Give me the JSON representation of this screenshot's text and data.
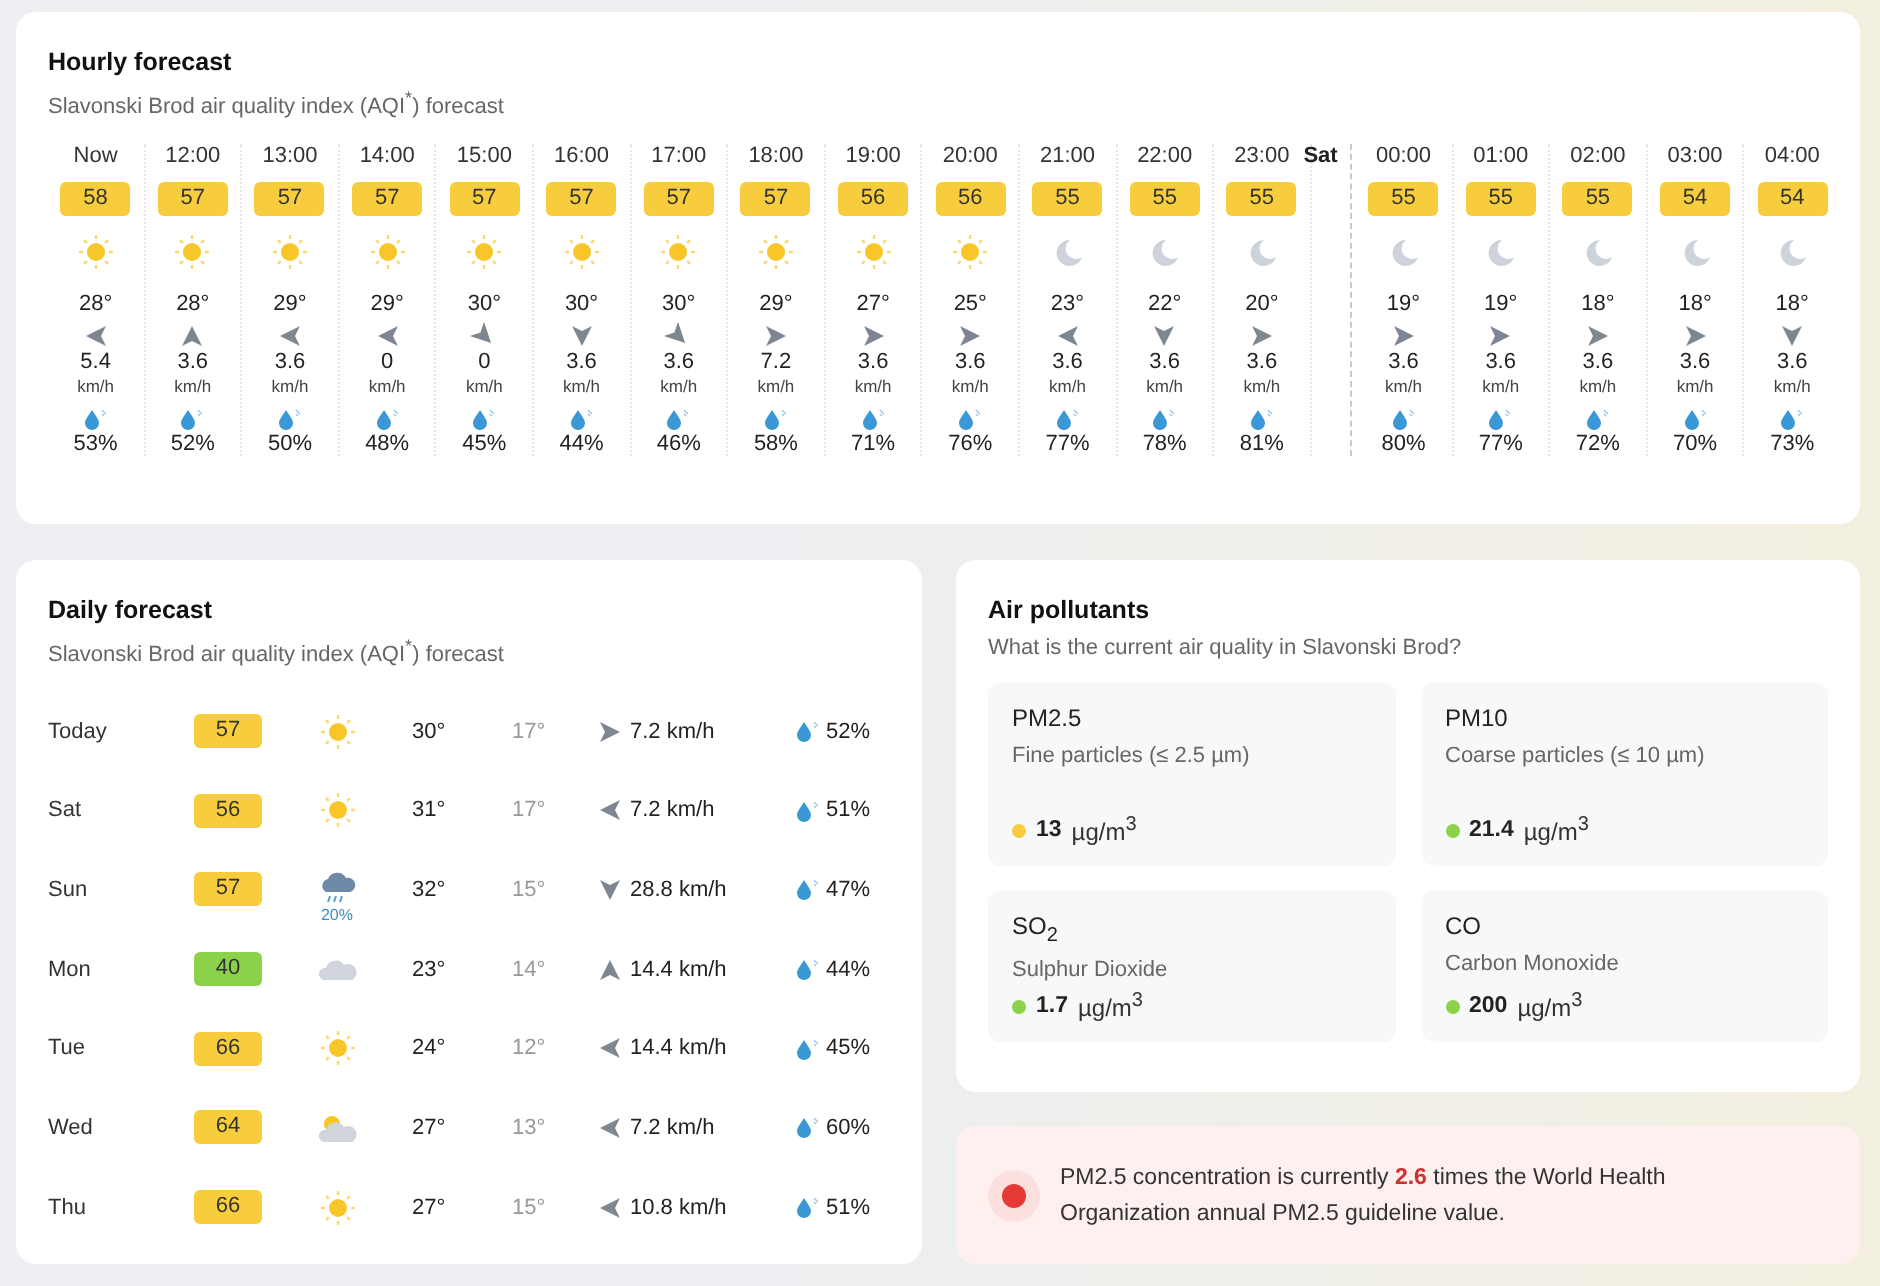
{
  "hourly": {
    "title": "Hourly forecast",
    "subtitle": "Slavonski Brod air quality index (AQI$^{*}$) forecast",
    "days": [
      {
        "hours": [
          {
            "kind": "sun",
            "time": "Now",
            "aqi": "58",
            "color": "#f8cd3d",
            "temp": "28°",
            "wind": {
              "kind": "W",
              "speed": "5.4",
              "unit": "km/h"
            },
            "humidity": "53%"
          },
          {
            "kind": "sun",
            "time": "12:00",
            "aqi": "57",
            "color": "#f8cd3d",
            "temp": "28°",
            "wind": {
              "kind": "N",
              "speed": "3.6",
              "unit": "km/h"
            },
            "humidity": "52%"
          },
          {
            "kind": "sun",
            "time": "13:00",
            "aqi": "57",
            "color": "#f8cd3d",
            "temp": "29°",
            "wind": {
              "kind": "W",
              "speed": "3.6",
              "unit": "km/h"
            },
            "humidity": "50%"
          },
          {
            "kind": "sun",
            "time": "14:00",
            "aqi": "57",
            "color": "#f8cd3d",
            "temp": "29°",
            "wind": {
              "kind": "W",
              "speed": "0",
              "unit": "km/h"
            },
            "humidity": "48%"
          },
          {
            "kind": "sun",
            "time": "15:00",
            "aqi": "57",
            "color": "#f8cd3d",
            "temp": "30°",
            "wind": {
              "kind": "SE",
              "speed": "0",
              "unit": "km/h"
            },
            "humidity": "45%"
          },
          {
            "kind": "sun",
            "time": "16:00",
            "aqi": "57",
            "color": "#f8cd3d",
            "temp": "30°",
            "wind": {
              "kind": "S",
              "speed": "3.6",
              "unit": "km/h"
            },
            "humidity": "44%"
          },
          {
            "kind": "sun",
            "time": "17:00",
            "aqi": "57",
            "color": "#f8cd3d",
            "temp": "30°",
            "wind": {
              "kind": "SE",
              "speed": "3.6",
              "unit": "km/h"
            },
            "humidity": "46%"
          },
          {
            "kind": "sun",
            "time": "18:00",
            "aqi": "57",
            "color": "#f8cd3d",
            "temp": "29°",
            "wind": {
              "kind": "E",
              "speed": "7.2",
              "unit": "km/h"
            },
            "humidity": "58%"
          },
          {
            "kind": "sun",
            "time": "19:00",
            "aqi": "56",
            "color": "#f8cd3d",
            "temp": "27°",
            "wind": {
              "kind": "E",
              "speed": "3.6",
              "unit": "km/h"
            },
            "humidity": "71%"
          },
          {
            "kind": "sun",
            "time": "20:00",
            "aqi": "56",
            "color": "#f8cd3d",
            "temp": "25°",
            "wind": {
              "kind": "E",
              "speed": "3.6",
              "unit": "km/h"
            },
            "humidity": "76%"
          },
          {
            "kind": "moon",
            "time": "21:00",
            "aqi": "55",
            "color": "#f8cd3d",
            "temp": "23°",
            "wind": {
              "kind": "W",
              "speed": "3.6",
              "unit": "km/h"
            },
            "humidity": "77%"
          },
          {
            "kind": "moon",
            "time": "22:00",
            "aqi": "55",
            "color": "#f8cd3d",
            "temp": "22°",
            "wind": {
              "kind": "S",
              "speed": "3.6",
              "unit": "km/h"
            },
            "humidity": "78%"
          },
          {
            "kind": "moon",
            "time": "23:00",
            "aqi": "55",
            "color": "#f8cd3d",
            "temp": "20°",
            "wind": {
              "kind": "E",
              "speed": "3.6",
              "unit": "km/h"
            },
            "humidity": "81%"
          }
        ]
      },
      {
        "label": "Sat",
        "hours": [
          {
            "kind": "moon",
            "time": "00:00",
            "aqi": "55",
            "color": "#f8cd3d",
            "temp": "19°",
            "wind": {
              "kind": "E",
              "speed": "3.6",
              "unit": "km/h"
            },
            "humidity": "80%"
          },
          {
            "kind": "moon",
            "time": "01:00",
            "aqi": "55",
            "color": "#f8cd3d",
            "temp": "19°",
            "wind": {
              "kind": "E",
              "speed": "3.6",
              "unit": "km/h"
            },
            "humidity": "77%"
          },
          {
            "kind": "moon",
            "time": "02:00",
            "aqi": "55",
            "color": "#f8cd3d",
            "temp": "18°",
            "wind": {
              "kind": "E",
              "speed": "3.6",
              "unit": "km/h"
            },
            "humidity": "72%"
          },
          {
            "kind": "moon",
            "time": "03:00",
            "aqi": "54",
            "color": "#f8cd3d",
            "temp": "18°",
            "wind": {
              "kind": "E",
              "speed": "3.6",
              "unit": "km/h"
            },
            "humidity": "70%"
          },
          {
            "kind": "moon",
            "time": "04:00",
            "aqi": "54",
            "color": "#f8cd3d",
            "temp": "18°",
            "wind": {
              "kind": "S",
              "speed": "3.6",
              "unit": "km/h"
            },
            "humidity": "73%"
          }
        ]
      }
    ]
  },
  "daily": {
    "title": "Daily forecast",
    "subtitle": "Slavonski Brod air quality index (AQI$^{*}$) forecast",
    "rows": [
      {
        "kind": "sun",
        "day": "Today",
        "aqi": "57",
        "color": "#f8cd3d",
        "high": "30°",
        "low": "17°",
        "wind": {
          "kind": "E",
          "speed": "7.2 km/h"
        },
        "humidity": "52%"
      },
      {
        "kind": "sun",
        "day": "Sat",
        "aqi": "56",
        "color": "#f8cd3d",
        "high": "31°",
        "low": "17°",
        "wind": {
          "kind": "W",
          "speed": "7.2 km/h"
        },
        "humidity": "51%"
      },
      {
        "kind": "rain",
        "day": "Sun",
        "aqi": "57",
        "color": "#f8cd3d",
        "chance": "20%",
        "high": "32°",
        "low": "15°",
        "wind": {
          "kind": "S",
          "speed": "28.8 km/h"
        },
        "humidity": "47%"
      },
      {
        "kind": "cloud",
        "day": "Mon",
        "aqi": "40",
        "color": "#8bd14a",
        "high": "23°",
        "low": "14°",
        "wind": {
          "kind": "N",
          "speed": "14.4 km/h"
        },
        "humidity": "44%"
      },
      {
        "kind": "sun",
        "day": "Tue",
        "aqi": "66",
        "color": "#f8cd3d",
        "high": "24°",
        "low": "12°",
        "wind": {
          "kind": "W",
          "speed": "14.4 km/h"
        },
        "humidity": "45%"
      },
      {
        "kind": "partly",
        "day": "Wed",
        "aqi": "64",
        "color": "#f8cd3d",
        "high": "27°",
        "low": "13°",
        "wind": {
          "kind": "W",
          "speed": "7.2 km/h"
        },
        "humidity": "60%"
      },
      {
        "kind": "sun",
        "day": "Thu",
        "aqi": "66",
        "color": "#f8cd3d",
        "high": "27°",
        "low": "15°",
        "wind": {
          "kind": "W",
          "speed": "10.8 km/h"
        },
        "humidity": "51%"
      }
    ]
  },
  "pollutants": {
    "title": "Air pollutants",
    "subtitle": "What is the current air quality in Slavonski Brod?",
    "items": [
      {
        "name": "PM2.5",
        "description": "Fine particles (≤ 2.5 µm)",
        "value": "13",
        "unit": "µg/m$^{3}$",
        "color": "#f8cd3d"
      },
      {
        "name": "PM10",
        "description": "Coarse particles (≤ 10 µm)",
        "value": "21.4",
        "unit": "µg/m$^{3}$",
        "color": "#8bd14a"
      },
      {
        "name": "SO$_{2}$",
        "description": "Sulphur Dioxide",
        "value": "1.7",
        "unit": "µg/m$^{3}$",
        "color": "#8bd14a"
      },
      {
        "name": "CO",
        "description": "Carbon Monoxide",
        "value": "200",
        "unit": "µg/m$^{3}$",
        "color": "#8bd14a"
      }
    ]
  },
  "alert": {
    "text": "PM2.5 concentration is currently **2.6** times the World Health Organization annual PM2.5 guideline value."
  }
}
